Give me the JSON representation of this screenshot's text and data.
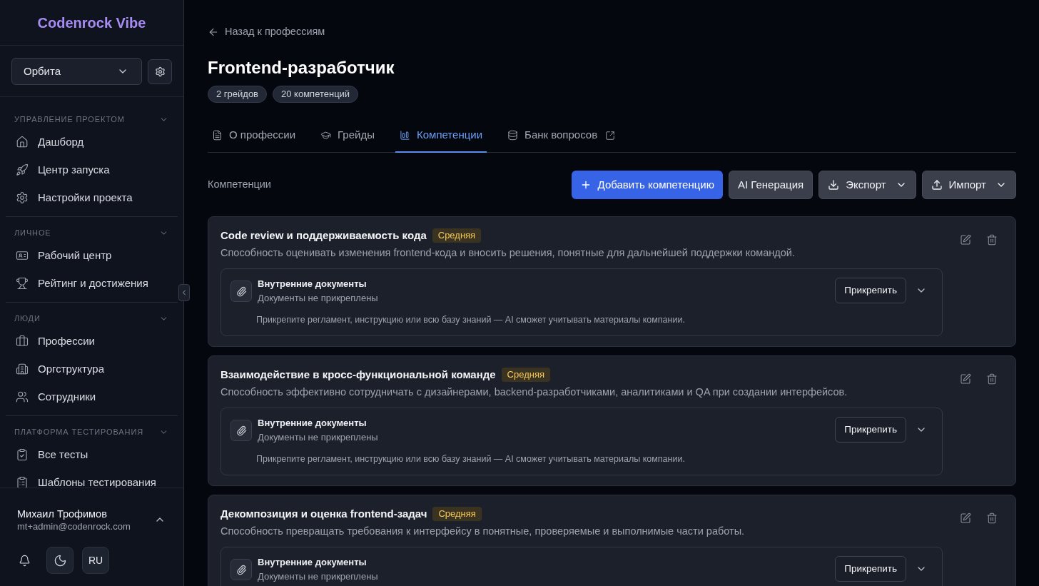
{
  "sidebar": {
    "logo": "Codenrock Vibe",
    "project_select": {
      "value": "Орбита"
    },
    "sections": [
      {
        "title": "УПРАВЛЕНИЕ ПРОЕКТОМ",
        "expanded": true,
        "items": [
          {
            "label": "Дашборд",
            "selected": false
          },
          {
            "label": "Центр запуска",
            "selected": false
          },
          {
            "label": "Настройки проекта",
            "selected": false
          }
        ]
      },
      {
        "title": "ЛИЧНОЕ",
        "expanded": true,
        "items": [
          {
            "label": "Рабочий центр",
            "selected": false
          },
          {
            "label": "Рейтинг и достижения",
            "selected": false
          }
        ]
      },
      {
        "title": "ЛЮДИ",
        "expanded": true,
        "items": [
          {
            "label": "Профессии",
            "selected": false
          },
          {
            "label": "Оргструктура",
            "selected": false
          },
          {
            "label": "Сотрудники",
            "selected": false
          }
        ]
      },
      {
        "title": "ПЛАТФОРМА ТЕСТИРОВАНИЯ",
        "expanded": true,
        "items": [
          {
            "label": "Все тесты",
            "selected": false
          },
          {
            "label": "Шаблоны тестирования",
            "selected": false
          }
        ]
      }
    ],
    "user": {
      "name": "Михаил Трофимов",
      "email": "mt+admin@codenrock.com"
    },
    "language_button": "RU"
  },
  "back_link": "Назад к профессиям",
  "title": "Frontend-разработчик",
  "badges": [
    "2 грейдов",
    "20 компетенций"
  ],
  "tabs": [
    {
      "label": "О профессии",
      "selected": false,
      "external": false
    },
    {
      "label": "Грейды",
      "selected": false,
      "external": false
    },
    {
      "label": "Компетенции",
      "selected": true,
      "external": false
    },
    {
      "label": "Банк вопросов",
      "selected": false,
      "external": true
    }
  ],
  "toolbar": {
    "label": "Компетенции",
    "buttons": [
      {
        "label": "Добавить компетенцию",
        "kind": "add"
      },
      {
        "label": "AI Генерация",
        "kind": "plain"
      },
      {
        "label": "Экспорт",
        "kind": "export"
      },
      {
        "label": "Импорт",
        "kind": "import"
      }
    ]
  },
  "competencies": [
    {
      "title": "Code review и поддерживаемость кода",
      "grade": "Средняя",
      "description": "Способность оценивать изменения frontend-кода и вносить решения, понятные для дальнейшей поддержки командой.",
      "documents": {
        "title": "Внутренние документы",
        "status": "Документы не прикреплены",
        "hint": "Прикрепите регламент, инструкцию или всю базу знаний — AI сможет учитывать материалы компании.",
        "action": "Прикрепить"
      }
    },
    {
      "title": "Взаимодействие в кросс-функциональной команде",
      "grade": "Средняя",
      "description": "Способность эффективно сотрудничать с дизайнерами, backend-разработчиками, аналитиками и QA при создании интерфейсов.",
      "documents": {
        "title": "Внутренние документы",
        "status": "Документы не прикреплены",
        "hint": "Прикрепите регламент, инструкцию или всю базу знаний — AI сможет учитывать материалы компании.",
        "action": "Прикрепить"
      }
    },
    {
      "title": "Декомпозиция и оценка frontend-задач",
      "grade": "Средняя",
      "description": "Способность превращать требования к интерфейсу в понятные, проверяемые и выполнимые части работы.",
      "documents": {
        "title": "Внутренние документы",
        "status": "Документы не прикреплены",
        "action": "Прикрепить"
      }
    }
  ]
}
